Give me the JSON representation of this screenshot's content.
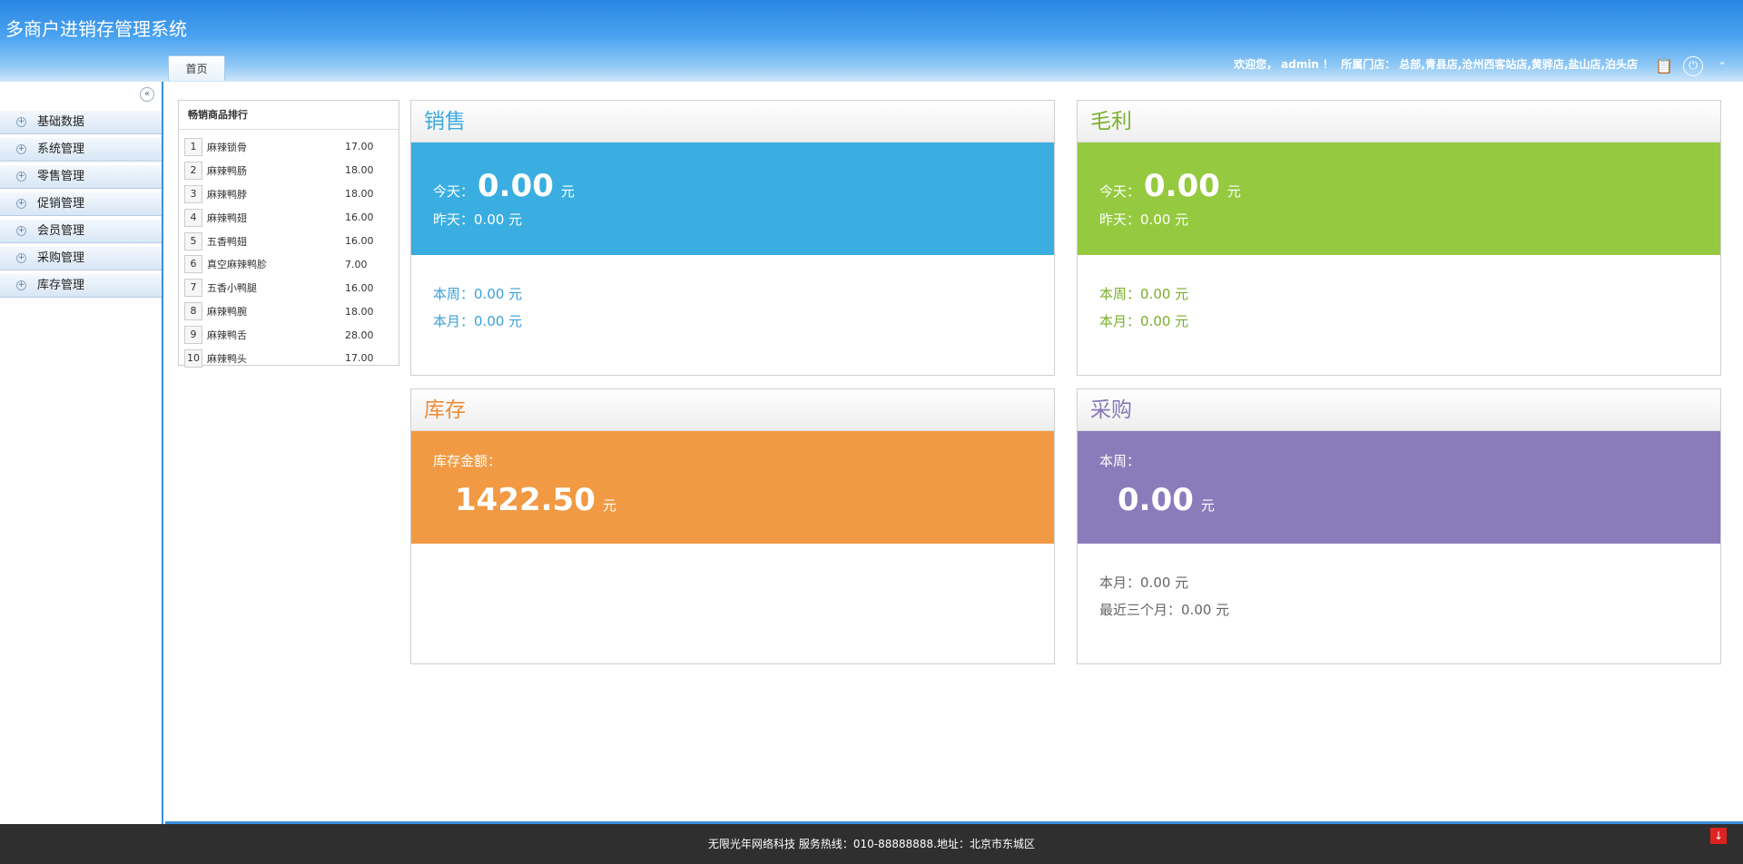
{
  "app": {
    "title": "多商户进销存管理系统"
  },
  "header": {
    "welcome_prefix": "欢迎您，",
    "username": "admin",
    "welcome_suffix": "！",
    "store_label": "所属门店：",
    "stores": "总部,青县店,沧州西客站店,黄骅店,盐山店,泊头店",
    "icons": [
      "clipboard-icon",
      "power-icon",
      "double-chevron-up-icon"
    ]
  },
  "tabs": [
    {
      "label": "首页"
    }
  ],
  "sidebar": {
    "items": [
      {
        "label": "基础数据"
      },
      {
        "label": "系统管理"
      },
      {
        "label": "零售管理"
      },
      {
        "label": "促销管理"
      },
      {
        "label": "会员管理"
      },
      {
        "label": "采购管理"
      },
      {
        "label": "库存管理"
      }
    ]
  },
  "ranking": {
    "title": "畅销商品排行",
    "rows": [
      {
        "no": "1",
        "name": "麻辣锁骨",
        "value": "17.00"
      },
      {
        "no": "2",
        "name": "麻辣鸭肠",
        "value": "18.00"
      },
      {
        "no": "3",
        "name": "麻辣鸭脖",
        "value": "18.00"
      },
      {
        "no": "4",
        "name": "麻辣鸭翅",
        "value": "16.00"
      },
      {
        "no": "5",
        "name": "五香鸭翅",
        "value": "16.00"
      },
      {
        "no": "6",
        "name": "真空麻辣鸭胗",
        "value": "7.00"
      },
      {
        "no": "7",
        "name": "五香小鸭腿",
        "value": "16.00"
      },
      {
        "no": "8",
        "name": "麻辣鸭腕",
        "value": "18.00"
      },
      {
        "no": "9",
        "name": "麻辣鸭舌",
        "value": "28.00"
      },
      {
        "no": "10",
        "name": "麻辣鸭头",
        "value": "17.00"
      }
    ]
  },
  "sales": {
    "title": "销售",
    "today_label": "今天：",
    "today_value": "0.00",
    "unit": "元",
    "yesterday_label": "昨天：",
    "yesterday_value": "0.00 元",
    "week_label": "本周：",
    "week_value": "0.00 元",
    "month_label": "本月：",
    "month_value": "0.00 元"
  },
  "profit": {
    "title": "毛利",
    "today_label": "今天：",
    "today_value": "0.00",
    "unit": "元",
    "yesterday_label": "昨天：",
    "yesterday_value": "0.00 元",
    "week_label": "本周：",
    "week_value": "0.00 元",
    "month_label": "本月：",
    "month_value": "0.00 元"
  },
  "stock": {
    "title": "库存",
    "amount_label": "库存金额：",
    "amount_value": "1422.50",
    "unit": "元"
  },
  "purchase": {
    "title": "采购",
    "week_label": "本周：",
    "week_value": "0.00",
    "unit": "元",
    "month_label": "本月：",
    "month_value": "0.00 元",
    "three_month_label": "最近三个月：",
    "three_month_value": "0.00 元"
  },
  "footer": {
    "text": "无限光年网络科技 服务热线：010-88888888.地址：北京市东城区"
  }
}
